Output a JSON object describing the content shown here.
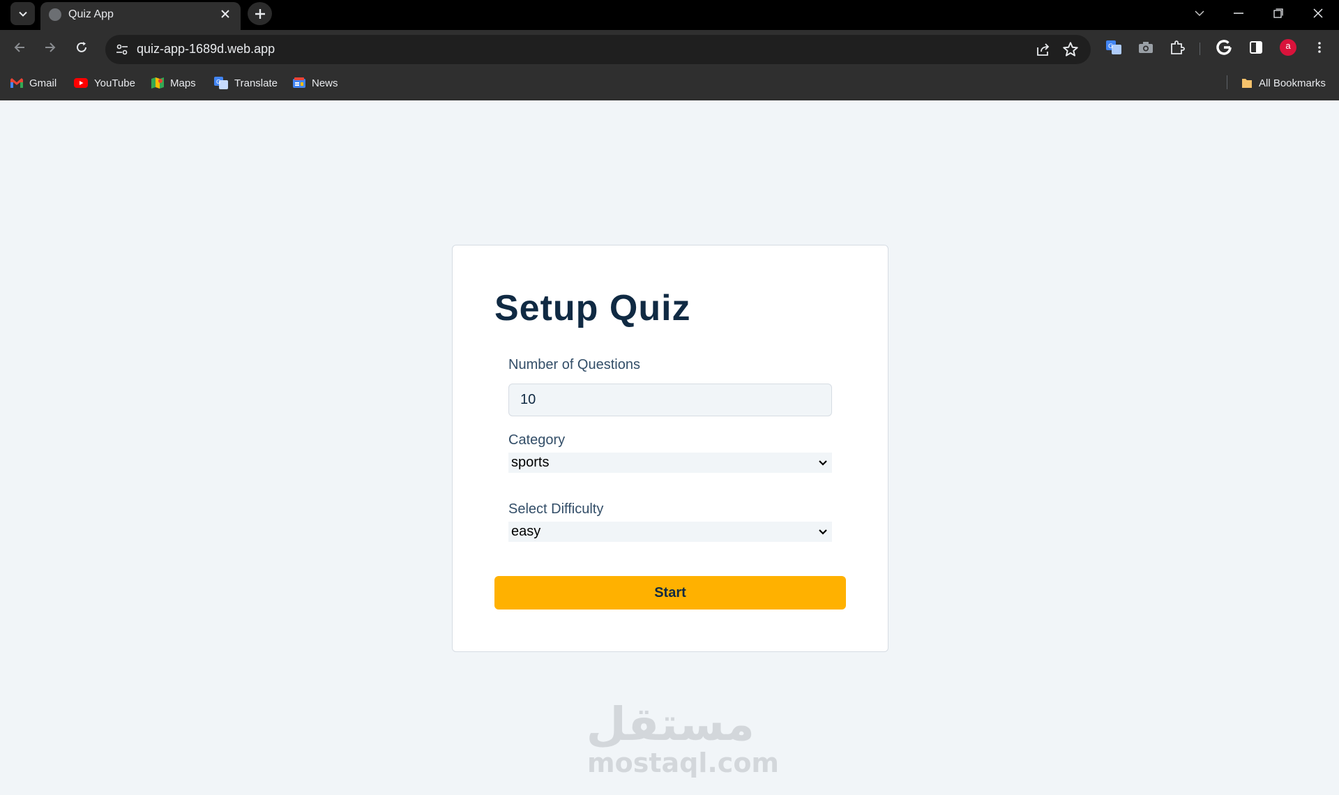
{
  "browser": {
    "tab_title": "Quiz App",
    "url": "quiz-app-1689d.web.app",
    "profile_initial": "a",
    "bookmarks": [
      {
        "label": "Gmail",
        "color": "#ea4335"
      },
      {
        "label": "YouTube",
        "color": "#ff0000"
      },
      {
        "label": "Maps",
        "color": "#34a853"
      },
      {
        "label": "Translate",
        "color": "#4285f4"
      },
      {
        "label": "News",
        "color": "#4285f4"
      }
    ],
    "all_bookmarks_label": "All Bookmarks"
  },
  "quiz": {
    "title": "Setup Quiz",
    "questions_label": "Number of Questions",
    "questions_value": "10",
    "category_label": "Category",
    "category_value": "sports",
    "difficulty_label": "Select Difficulty",
    "difficulty_value": "easy",
    "start_label": "Start",
    "accent": "#ffb100"
  },
  "watermark": {
    "arabic": "مستقل",
    "latin": "mostaql.com"
  }
}
